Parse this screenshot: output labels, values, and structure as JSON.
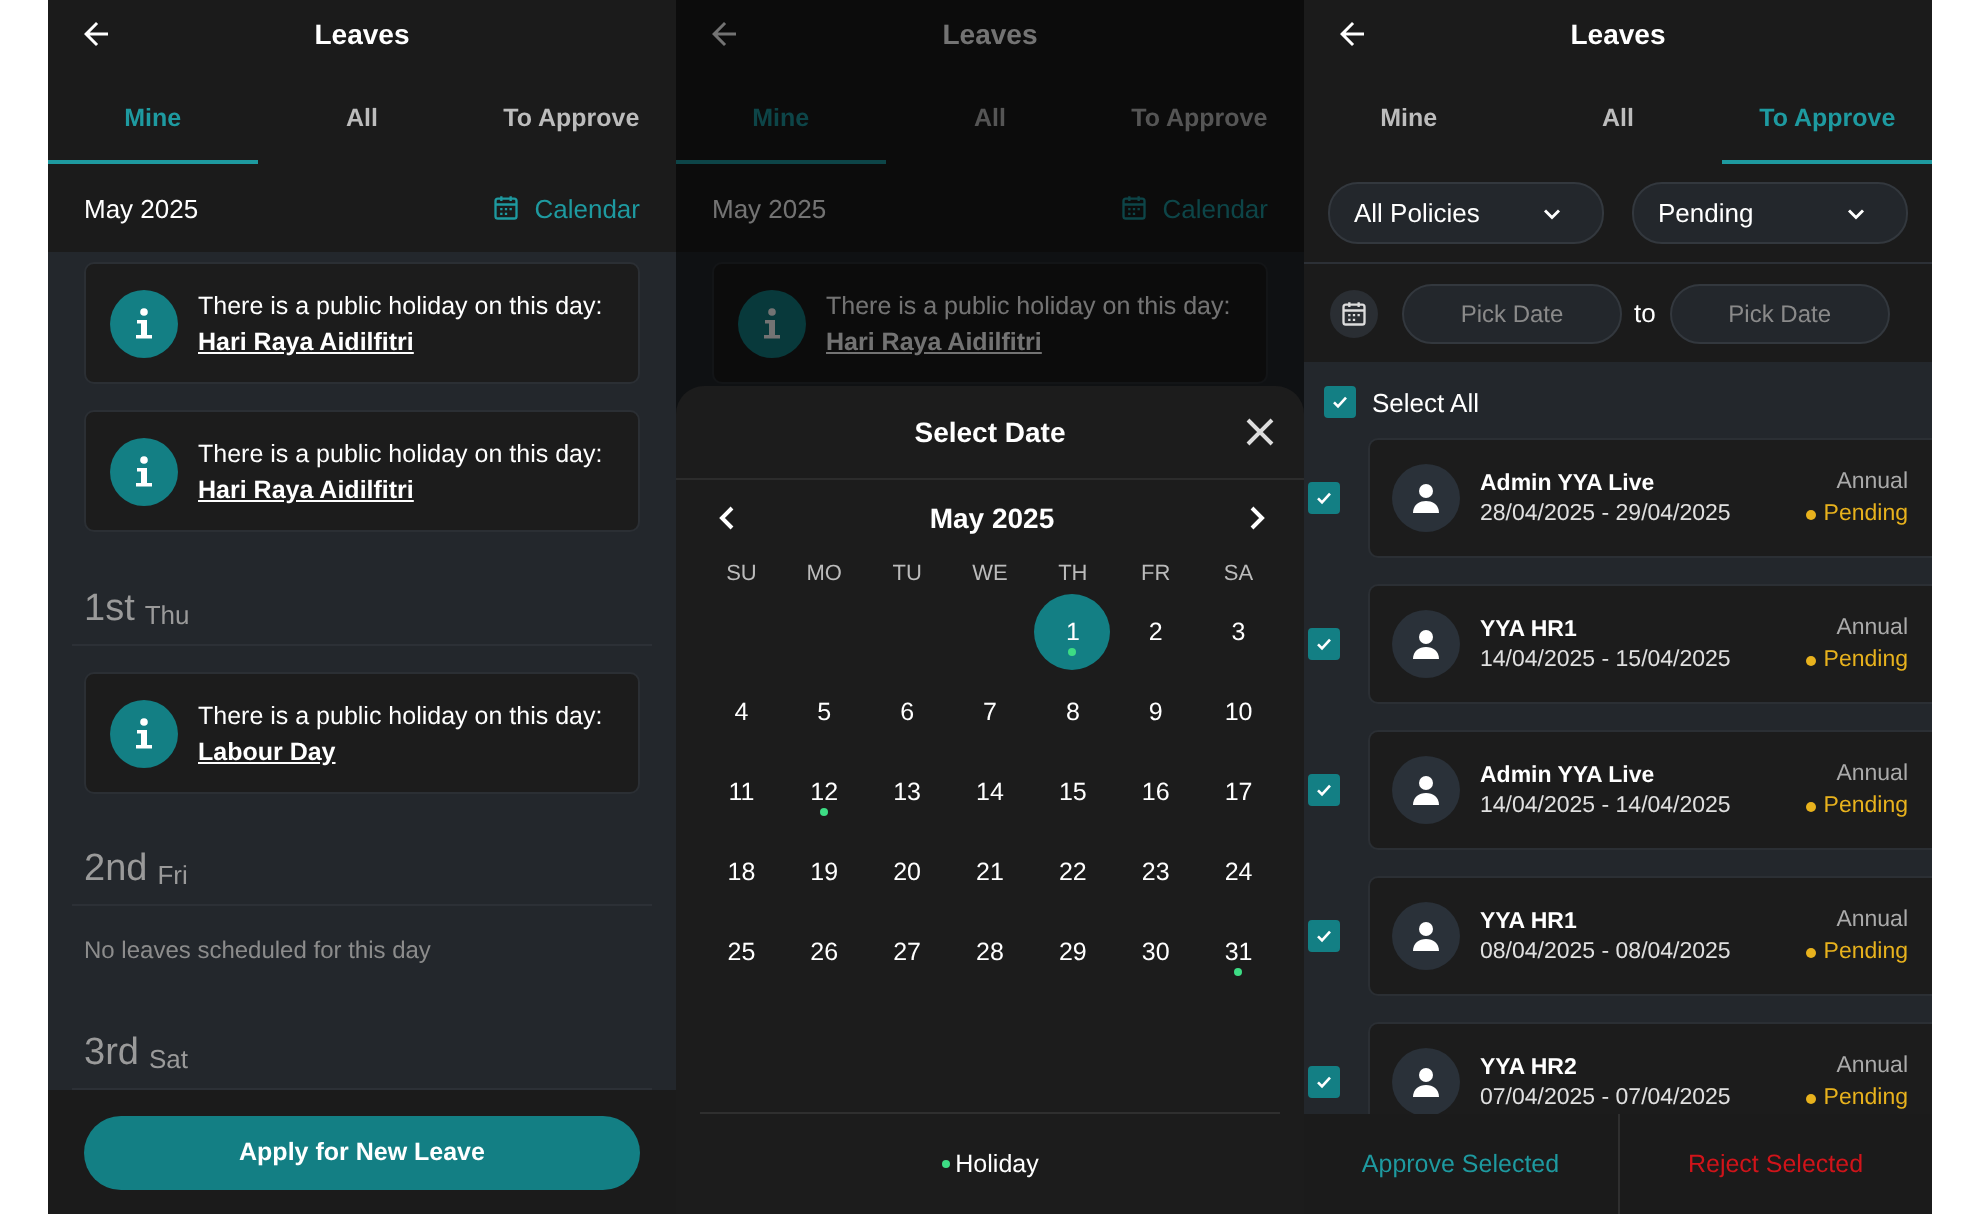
{
  "screens": [
    {
      "kind": "mine",
      "title": "Leaves",
      "tabs": [
        {
          "label": "Mine",
          "selected": true
        },
        {
          "label": "All",
          "selected": false
        },
        {
          "label": "To Approve",
          "selected": false
        }
      ],
      "month": "May 2025",
      "calendar_link": "Calendar",
      "entries": [
        {
          "kind": "holiday",
          "text": "There is a public holiday on this day:",
          "holiday": "Hari Raya Aidilfitri"
        },
        {
          "kind": "holiday",
          "text": "There is a public holiday on this day:",
          "holiday": "Hari Raya Aidilfitri"
        },
        {
          "kind": "day",
          "day": "1st",
          "weekday": "Thu"
        },
        {
          "kind": "holiday",
          "text": "There is a public holiday on this day:",
          "holiday": "Labour Day"
        },
        {
          "kind": "day",
          "day": "2nd",
          "weekday": "Fri"
        },
        {
          "kind": "empty",
          "text": "No leaves scheduled for this day"
        },
        {
          "kind": "day",
          "day": "3rd",
          "weekday": "Sat"
        }
      ],
      "apply_button": "Apply for New Leave"
    },
    {
      "kind": "picker",
      "title": "Leaves",
      "tabs": [
        {
          "label": "Mine",
          "selected": true
        },
        {
          "label": "All",
          "selected": false
        },
        {
          "label": "To Approve",
          "selected": false
        }
      ],
      "month": "May 2025",
      "calendar_link": "Calendar",
      "entries": [
        {
          "kind": "holiday",
          "text": "There is a public holiday on this day:",
          "holiday": "Hari Raya Aidilfitri"
        }
      ],
      "sheet": {
        "title": "Select Date",
        "month": "May 2025",
        "weekdays": [
          "SU",
          "MO",
          "TU",
          "WE",
          "TH",
          "FR",
          "SA"
        ],
        "weeks": [
          [
            {
              "day": "1",
              "selected": true,
              "holiday": true
            },
            {
              "day": "2",
              "selected": false,
              "holiday": false
            },
            {
              "day": "3",
              "selected": false,
              "holiday": false
            }
          ],
          [
            {
              "day": "4",
              "selected": false,
              "holiday": false
            },
            {
              "day": "5",
              "selected": false,
              "holiday": false
            },
            {
              "day": "6",
              "selected": false,
              "holiday": false
            },
            {
              "day": "7",
              "selected": false,
              "holiday": false
            },
            {
              "day": "8",
              "selected": false,
              "holiday": false
            },
            {
              "day": "9",
              "selected": false,
              "holiday": false
            },
            {
              "day": "10",
              "selected": false,
              "holiday": false
            }
          ],
          [
            {
              "day": "11",
              "selected": false,
              "holiday": false
            },
            {
              "day": "12",
              "selected": false,
              "holiday": true
            },
            {
              "day": "13",
              "selected": false,
              "holiday": false
            },
            {
              "day": "14",
              "selected": false,
              "holiday": false
            },
            {
              "day": "15",
              "selected": false,
              "holiday": false
            },
            {
              "day": "16",
              "selected": false,
              "holiday": false
            },
            {
              "day": "17",
              "selected": false,
              "holiday": false
            }
          ],
          [
            {
              "day": "18",
              "selected": false,
              "holiday": false
            },
            {
              "day": "19",
              "selected": false,
              "holiday": false
            },
            {
              "day": "20",
              "selected": false,
              "holiday": false
            },
            {
              "day": "21",
              "selected": false,
              "holiday": false
            },
            {
              "day": "22",
              "selected": false,
              "holiday": false
            },
            {
              "day": "23",
              "selected": false,
              "holiday": false
            },
            {
              "day": "24",
              "selected": false,
              "holiday": false
            }
          ],
          [
            {
              "day": "25",
              "selected": false,
              "holiday": false
            },
            {
              "day": "26",
              "selected": false,
              "holiday": false
            },
            {
              "day": "27",
              "selected": false,
              "holiday": false
            },
            {
              "day": "28",
              "selected": false,
              "holiday": false
            },
            {
              "day": "29",
              "selected": false,
              "holiday": false
            },
            {
              "day": "30",
              "selected": false,
              "holiday": false
            },
            {
              "day": "31",
              "selected": false,
              "holiday": true
            }
          ]
        ],
        "legend": {
          "label": "Holiday",
          "color": "#3ddc84"
        }
      }
    },
    {
      "kind": "approve",
      "title": "Leaves",
      "tabs": [
        {
          "label": "Mine",
          "selected": false
        },
        {
          "label": "All",
          "selected": false
        },
        {
          "label": "To Approve",
          "selected": true
        }
      ],
      "filters": [
        {
          "value": "All Policies"
        },
        {
          "value": "Pending"
        }
      ],
      "date_from": {
        "placeholder": "Pick Date"
      },
      "range_separator": "to",
      "date_to": {
        "placeholder": "Pick Date"
      },
      "select_all": {
        "label": "Select All",
        "checked": true
      },
      "requests": [
        {
          "name": "Admin YYA Live",
          "dates": "28/04/2025 - 29/04/2025",
          "type": "Annual",
          "status": "Pending",
          "checked": true
        },
        {
          "name": "YYA HR1",
          "dates": "14/04/2025 - 15/04/2025",
          "type": "Annual",
          "status": "Pending",
          "checked": true
        },
        {
          "name": "Admin YYA Live",
          "dates": "14/04/2025 - 14/04/2025",
          "type": "Annual",
          "status": "Pending",
          "checked": true
        },
        {
          "name": "YYA HR1",
          "dates": "08/04/2025 - 08/04/2025",
          "type": "Annual",
          "status": "Pending",
          "checked": true
        },
        {
          "name": "YYA HR2",
          "dates": "07/04/2025 - 07/04/2025",
          "type": "Annual",
          "status": "Pending",
          "checked": true
        }
      ],
      "actions": [
        {
          "label": "Approve Selected",
          "kind": "approve"
        },
        {
          "label": "Reject Selected",
          "kind": "reject"
        }
      ]
    }
  ]
}
